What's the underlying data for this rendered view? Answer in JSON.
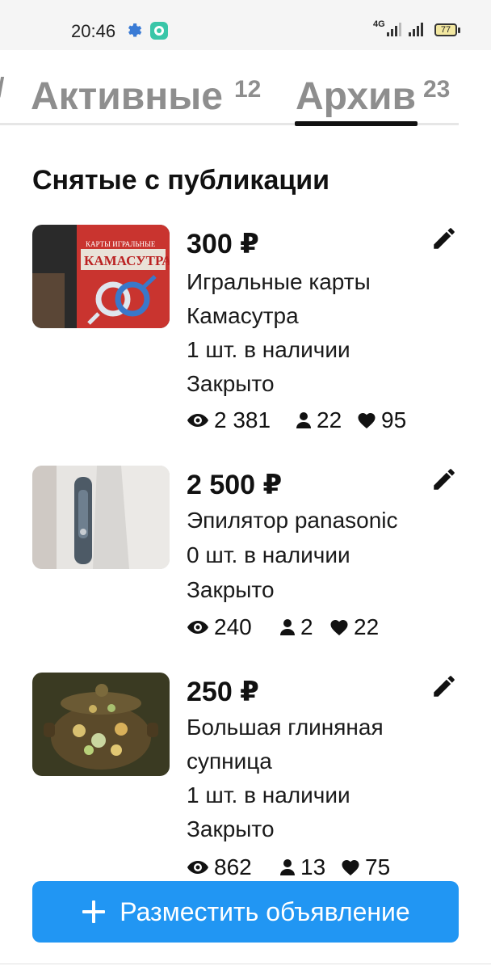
{
  "status_bar": {
    "time": "20:46",
    "network": "4G",
    "battery": "77",
    "icons": [
      "gear-icon",
      "app-notification-icon",
      "signal-icon",
      "signal-icon",
      "battery-icon"
    ]
  },
  "tabs": [
    {
      "label": "Активные",
      "count": "12",
      "selected": false
    },
    {
      "label": "Архив",
      "count": "23",
      "selected": true
    }
  ],
  "section_title": "Снятые с публикации",
  "listings": [
    {
      "price": "300 ₽",
      "title_lines": [
        "Игральные карты",
        "Камасутра"
      ],
      "stock": "1 шт. в наличии",
      "status": "Закрыто",
      "views": "2 381",
      "contacts": "22",
      "favorites": "95"
    },
    {
      "price": "2 500 ₽",
      "title_lines": [
        "Эпилятор panasonic"
      ],
      "stock": "0 шт. в наличии",
      "status": "Закрыто",
      "views": "240",
      "contacts": "2",
      "favorites": "22"
    },
    {
      "price": "250 ₽",
      "title_lines": [
        "Большая глиняная",
        "супница"
      ],
      "stock": "1 шт. в наличии",
      "status": "Закрыто",
      "views": "862",
      "contacts": "13",
      "favorites": "75"
    }
  ],
  "post_button": {
    "label": "Разместить объявление",
    "icon": "plus-icon"
  },
  "colors": {
    "accent": "#2196f3",
    "tab_inactive": "#8e8e8e",
    "text": "#111111"
  }
}
